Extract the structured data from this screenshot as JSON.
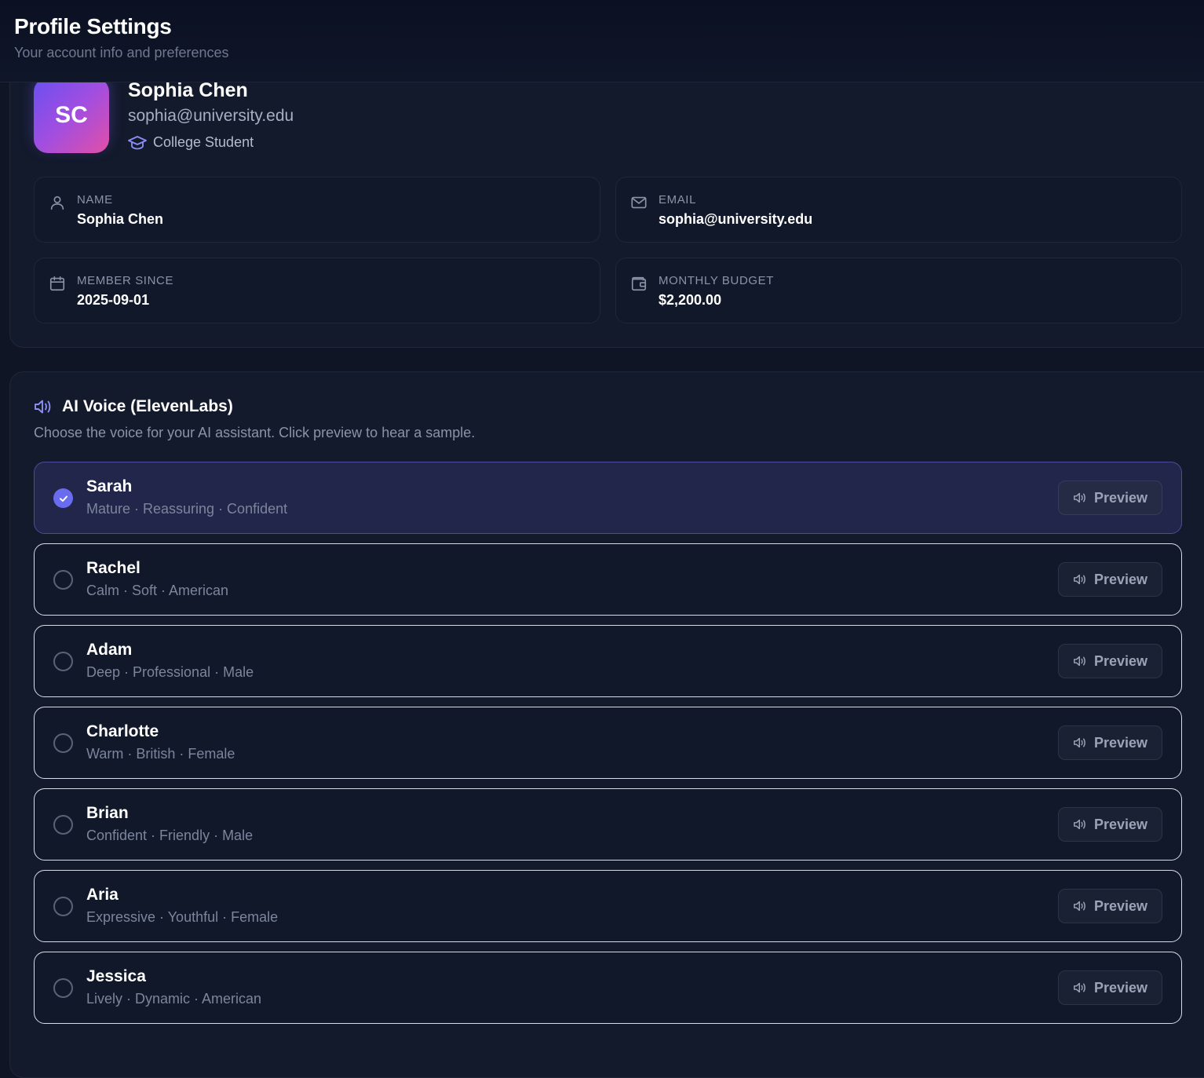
{
  "header": {
    "title": "Profile Settings",
    "subtitle": "Your account info and preferences"
  },
  "profile": {
    "initials": "SC",
    "name": "Sophia Chen",
    "email": "sophia@university.edu",
    "role": "College Student",
    "role_icon": "graduation-cap-icon",
    "fields": [
      {
        "label": "NAME",
        "value": "Sophia Chen",
        "icon": "user-icon"
      },
      {
        "label": "EMAIL",
        "value": "sophia@university.edu",
        "icon": "mail-icon"
      },
      {
        "label": "MEMBER SINCE",
        "value": "2025-09-01",
        "icon": "calendar-icon"
      },
      {
        "label": "MONTHLY BUDGET",
        "value": "$2,200.00",
        "icon": "wallet-icon"
      }
    ]
  },
  "voice_section": {
    "title": "AI Voice (ElevenLabs)",
    "description": "Choose the voice for your AI assistant. Click preview to hear a sample.",
    "preview_label": "Preview",
    "voices": [
      {
        "name": "Sarah",
        "tags": "Mature · Reassuring · Confident",
        "selected": true
      },
      {
        "name": "Rachel",
        "tags": "Calm · Soft · American",
        "selected": false
      },
      {
        "name": "Adam",
        "tags": "Deep · Professional · Male",
        "selected": false
      },
      {
        "name": "Charlotte",
        "tags": "Warm · British · Female",
        "selected": false
      },
      {
        "name": "Brian",
        "tags": "Confident · Friendly · Male",
        "selected": false
      },
      {
        "name": "Aria",
        "tags": "Expressive · Youthful · Female",
        "selected": false
      },
      {
        "name": "Jessica",
        "tags": "Lively · Dynamic · American",
        "selected": false
      }
    ]
  },
  "colors": {
    "background": "#0f1524",
    "accent": "#6a6cf0",
    "avatar_gradient_start": "#6a4ff0",
    "avatar_gradient_end": "#e24fa7"
  }
}
